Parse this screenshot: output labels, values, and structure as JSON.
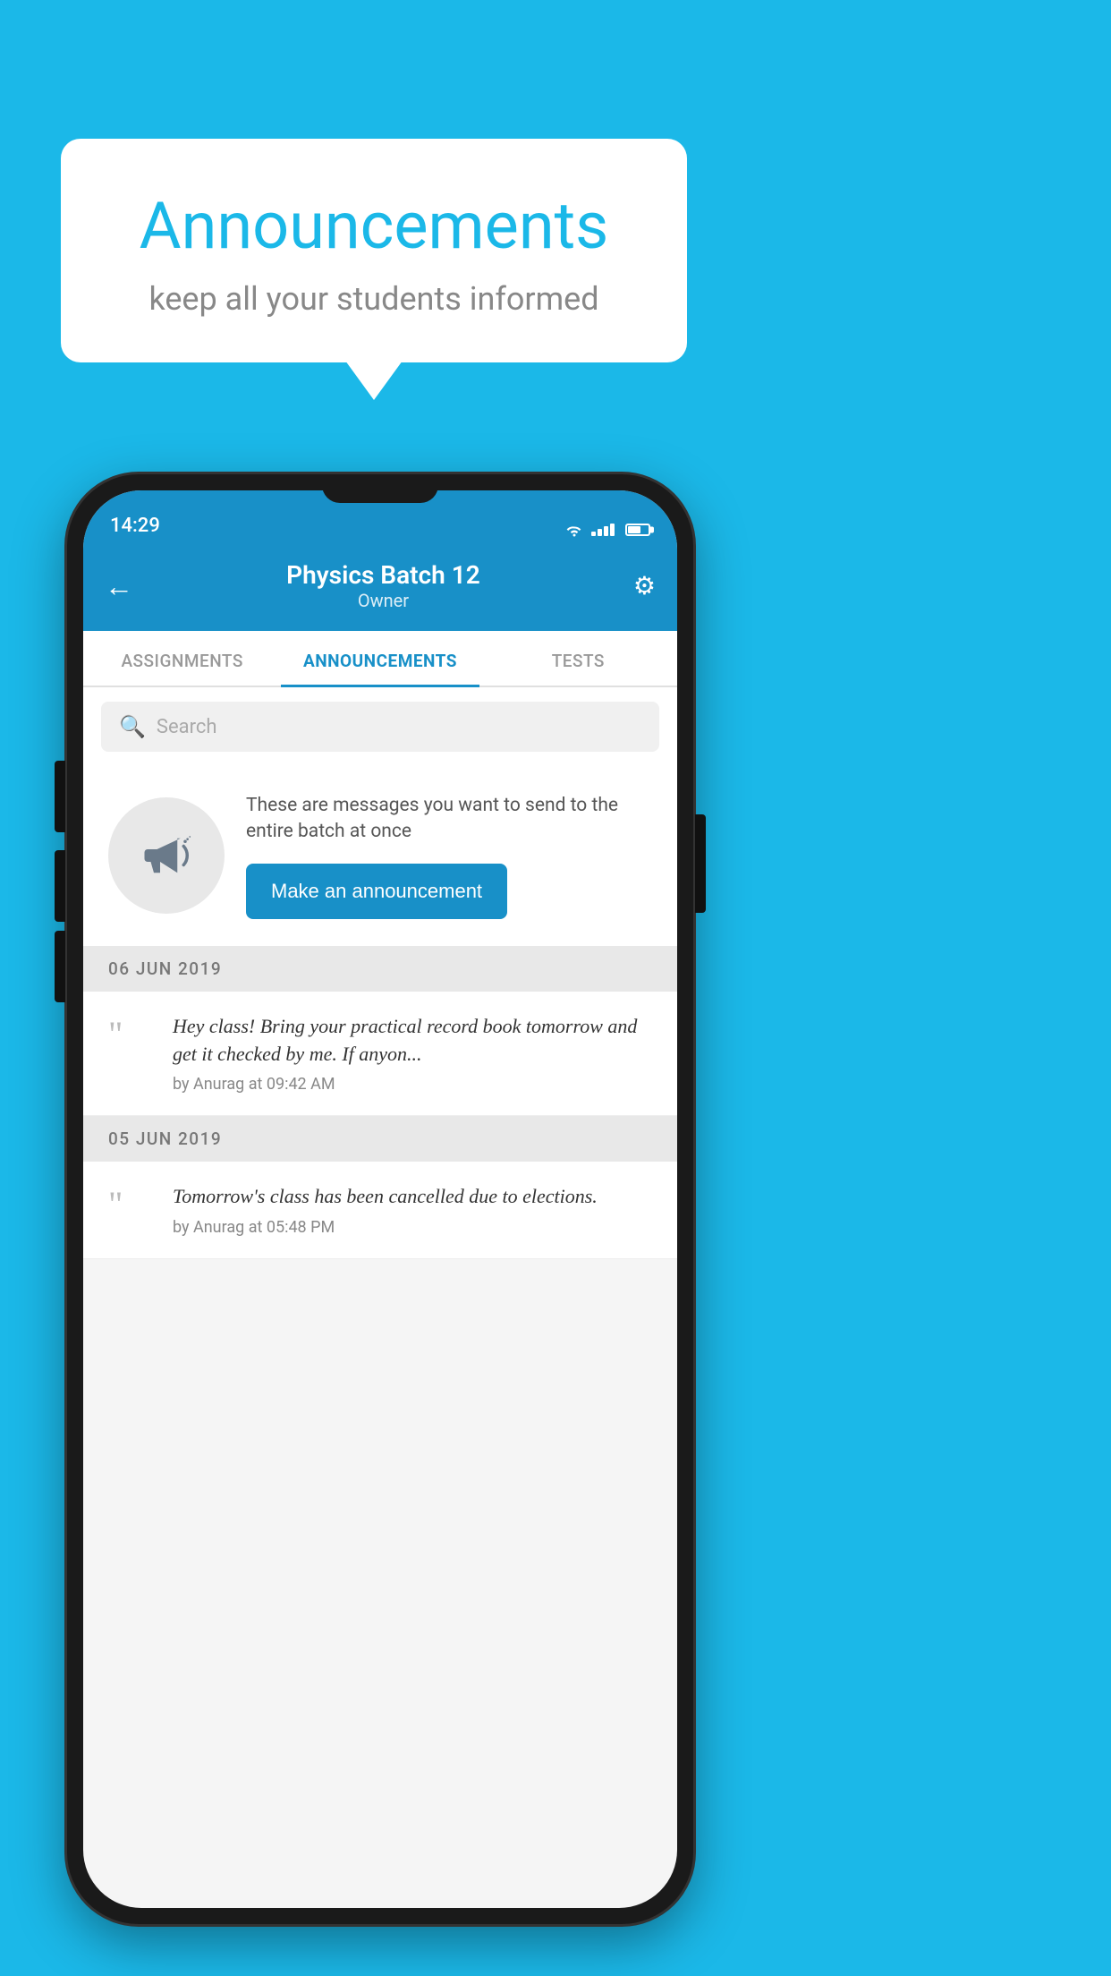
{
  "background_color": "#1BB8E8",
  "speech_bubble": {
    "title": "Announcements",
    "subtitle": "keep all your students informed"
  },
  "phone": {
    "status_bar": {
      "time": "14:29"
    },
    "header": {
      "title": "Physics Batch 12",
      "subtitle": "Owner",
      "back_label": "←",
      "gear_label": "⚙"
    },
    "tabs": [
      {
        "label": "ASSIGNMENTS",
        "active": false
      },
      {
        "label": "ANNOUNCEMENTS",
        "active": true
      },
      {
        "label": "TESTS",
        "active": false
      }
    ],
    "search": {
      "placeholder": "Search"
    },
    "promo": {
      "description": "These are messages you want to send to the entire batch at once",
      "button_label": "Make an announcement"
    },
    "announcements": [
      {
        "date": "06  JUN  2019",
        "text": "Hey class! Bring your practical record book tomorrow and get it checked by me. If anyon...",
        "meta": "by Anurag at 09:42 AM"
      },
      {
        "date": "05  JUN  2019",
        "text": "Tomorrow's class has been cancelled due to elections.",
        "meta": "by Anurag at 05:48 PM"
      }
    ]
  }
}
